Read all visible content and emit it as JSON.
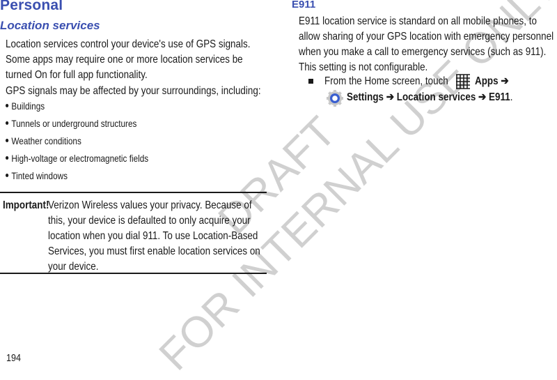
{
  "left_column": {
    "section_title": "Personal",
    "subsection_title": "Location services",
    "intro_lines": [
      "Location services control your device's use of GPS signals.",
      "Some apps may require one or more location services be",
      "turned On for full app functionality."
    ],
    "gps_intro": "GPS signals may be affected by your surroundings, including:",
    "bullets": [
      "Buildings",
      "Tunnels or underground structures",
      "Weather conditions",
      "High-voltage or electromagnetic fields",
      "Tinted windows"
    ],
    "note": {
      "label": "Important!",
      "lines": [
        "Verizon Wireless values your privacy. Because of",
        "this, your device is defaulted to only acquire your",
        "location when you dial 911. To use Location-Based",
        "Services, you must first enable location services on",
        "your device."
      ]
    }
  },
  "right_column": {
    "heading": "E911",
    "body_lines": [
      "E911 location service is standard on all mobile phones, to",
      "allow sharing of your GPS location with emergency personnel",
      "when you make a call to emergency services (such as 911).",
      "This setting is not configurable."
    ],
    "step": {
      "prefix": "From the Home screen, touch",
      "apps_icon": "apps-grid-icon",
      "apps_label": "Apps",
      "arrow": "➔",
      "settings_icon": "settings-gear-icon",
      "settings_label": "Settings",
      "location_label": "Location services",
      "e911_label": "E911",
      "end": "."
    }
  },
  "footer": {
    "page_number": "194"
  },
  "watermark": {
    "line1": "DRAFT",
    "line2": "FOR INTERNAL USE ONLY"
  },
  "colors": {
    "heading_blue": "#3a4fb0",
    "text": "#1a1a1a",
    "watermark": "#aaaaaa"
  }
}
